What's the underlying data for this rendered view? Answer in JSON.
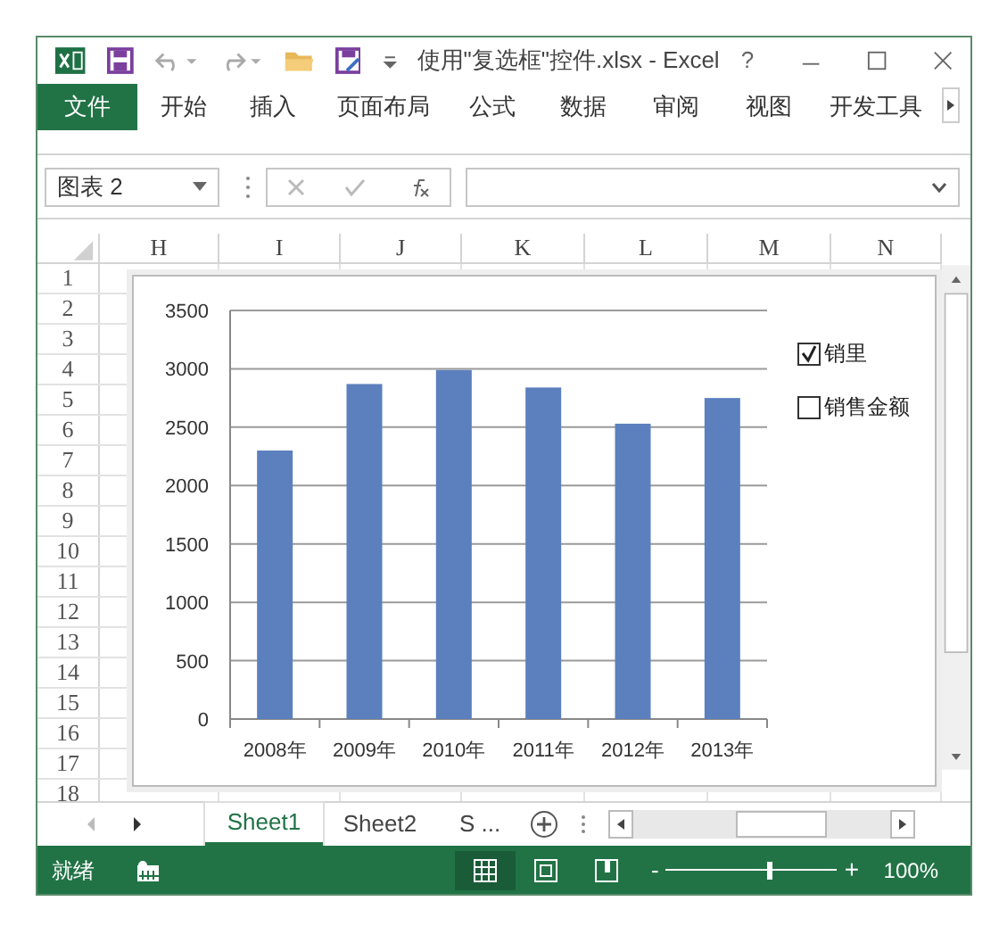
{
  "window": {
    "title": "使用\"复选框\"控件.xlsx - Excel",
    "help": "?"
  },
  "ribbon_tabs": [
    {
      "label": "文件",
      "selected": true
    },
    {
      "label": "开始",
      "selected": false
    },
    {
      "label": "插入",
      "selected": false
    },
    {
      "label": "页面布局",
      "selected": false
    },
    {
      "label": "公式",
      "selected": false
    },
    {
      "label": "数据",
      "selected": false
    },
    {
      "label": "审阅",
      "selected": false
    },
    {
      "label": "视图",
      "selected": false
    },
    {
      "label": "开发工具",
      "selected": false
    }
  ],
  "formula_bar": {
    "name_box": "图表 2"
  },
  "columns": [
    "H",
    "I",
    "J",
    "K",
    "L",
    "M",
    "N"
  ],
  "rows": [
    "1",
    "2",
    "3",
    "4",
    "5",
    "6",
    "7",
    "8",
    "9",
    "10",
    "11",
    "12",
    "13",
    "14",
    "15",
    "16",
    "17",
    "18"
  ],
  "chart": {
    "chart_data": {
      "type": "bar",
      "categories": [
        "2008年",
        "2009年",
        "2010年",
        "2011年",
        "2012年",
        "2013年"
      ],
      "series": [
        {
          "color": "#5b80bd",
          "values": [
            2300,
            2870,
            2990,
            2840,
            2530,
            2750
          ]
        }
      ],
      "grid": true,
      "ylim": [
        0,
        3500
      ],
      "yticks": [
        0,
        500,
        1000,
        1500,
        2000,
        2500,
        3000,
        3500
      ]
    },
    "checkboxes": [
      {
        "label": "销里",
        "checked": true
      },
      {
        "label": "销售金额",
        "checked": false
      }
    ]
  },
  "sheet_tabs": [
    {
      "label": "Sheet1",
      "selected": true
    },
    {
      "label": "Sheet2",
      "selected": false
    },
    {
      "label": "S ...",
      "selected": false
    }
  ],
  "status_bar": {
    "status": "就绪",
    "views": [
      {
        "kind": "normal",
        "selected": true
      },
      {
        "kind": "page_layout",
        "selected": false
      },
      {
        "kind": "page_break",
        "selected": false
      }
    ],
    "zoom": {
      "minus": "-",
      "plus": "+",
      "level": 0.6,
      "reading": "100%"
    }
  }
}
